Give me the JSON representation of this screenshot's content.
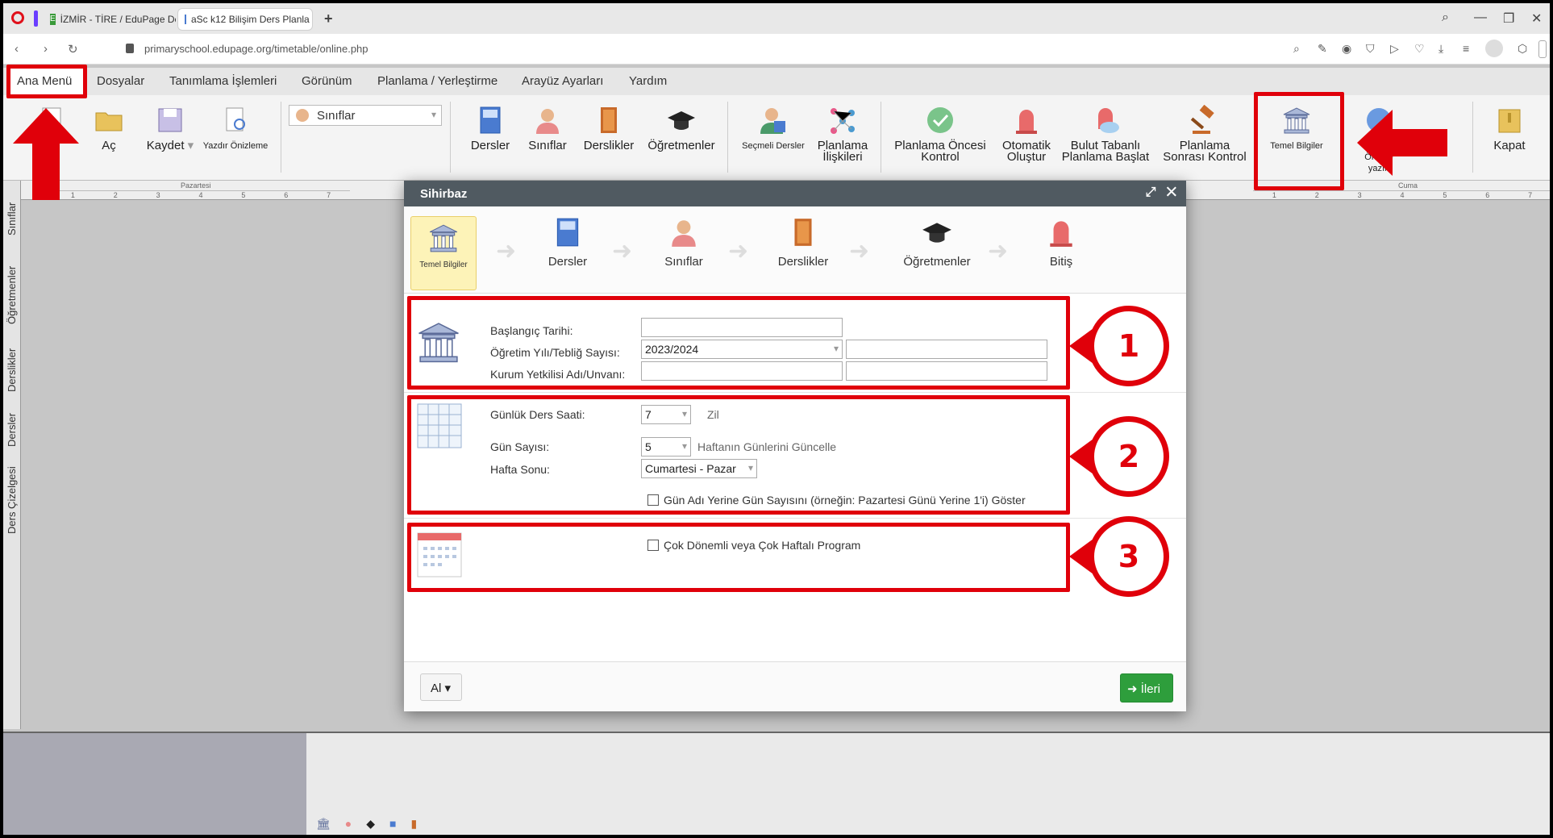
{
  "browser": {
    "tabs": [
      {
        "title": "İZMİR - TİRE / EduPage De"
      },
      {
        "title": "aSc k12 Bilişim Ders Planla"
      }
    ],
    "url": "primaryschool.edupage.org/timetable/online.php"
  },
  "menu": {
    "items": [
      "Ana Menü",
      "Dosyalar",
      "Tanımlama İşlemleri",
      "Görünüm",
      "Planlama / Yerleştirme",
      "Arayüz Ayarları",
      "Yardım"
    ]
  },
  "toolbar": {
    "open": "Aç",
    "save": "Kaydet",
    "print_preview": "Yazdır Önizleme",
    "combo_value": "Sınıflar",
    "lessons": "Dersler",
    "classes": "Sınıflar",
    "classrooms": "Derslikler",
    "teachers": "Öğretmenler",
    "elective": "Seçmeli Dersler",
    "relations_1": "Planlama",
    "relations_2": "İlişkileri",
    "precheck_1": "Planlama Öncesi",
    "precheck_2": "Kontrol",
    "auto_1": "Otomatik",
    "auto_2": "Oluştur",
    "cloud_1": "Bulut Tabanlı",
    "cloud_2": "Planlama Başlat",
    "postcheck_1": "Planlama",
    "postcheck_2": "Sonrası Kontrol",
    "basic_info": "Temel Bilgiler",
    "suggestions_1": "S",
    "suggestions_2": "Önerile",
    "suggestions_3": "yazın",
    "close": "Kapat"
  },
  "ruler": {
    "day_left": "Pazartesi",
    "day_right": "Cuma",
    "hours": [
      "1",
      "2",
      "3",
      "4",
      "5",
      "6",
      "7"
    ]
  },
  "sidetabs": [
    "Sınıflar",
    "Öğretmenler",
    "Derslikler",
    "Dersler",
    "Ders Çizelgesi"
  ],
  "dialog": {
    "title": "Sihirbaz",
    "steps": [
      {
        "label": "Temel Bilgiler"
      },
      {
        "label": "Dersler"
      },
      {
        "label": "Sınıflar"
      },
      {
        "label": "Derslikler"
      },
      {
        "label": "Öğretmenler"
      },
      {
        "label": "Bitiş"
      }
    ],
    "section1": {
      "start_date_label": "Başlangıç Tarihi:",
      "start_date_value": "",
      "year_label": "Öğretim Yılı/Tebliğ Sayısı:",
      "year_value": "2023/2024",
      "year_extra_value": "",
      "official_label": "Kurum Yetkilisi Adı/Unvanı:",
      "official_name_value": "",
      "official_title_value": ""
    },
    "section2": {
      "daily_hours_label": "Günlük Ders Saati:",
      "daily_hours_value": "7",
      "bell_link": "Zil",
      "days_label": "Gün Sayısı:",
      "days_value": "5",
      "update_days_link": "Haftanın Günlerini Güncelle",
      "weekend_label": "Hafta Sonu:",
      "weekend_value": "Cumartesi - Pazar",
      "show_day_number_label": "Gün Adı Yerine Gün Sayısını (örneğin: Pazartesi Günü Yerine 1'i) Göster"
    },
    "section3": {
      "multi_term_label": "Çok Dönemli veya Çok Haftalı Program"
    },
    "footer": {
      "al_button": "Al ▾",
      "next_button": "İleri"
    }
  },
  "annotations": {
    "numbers": [
      "1",
      "2",
      "3"
    ],
    "accent_color": "#e0000a"
  }
}
